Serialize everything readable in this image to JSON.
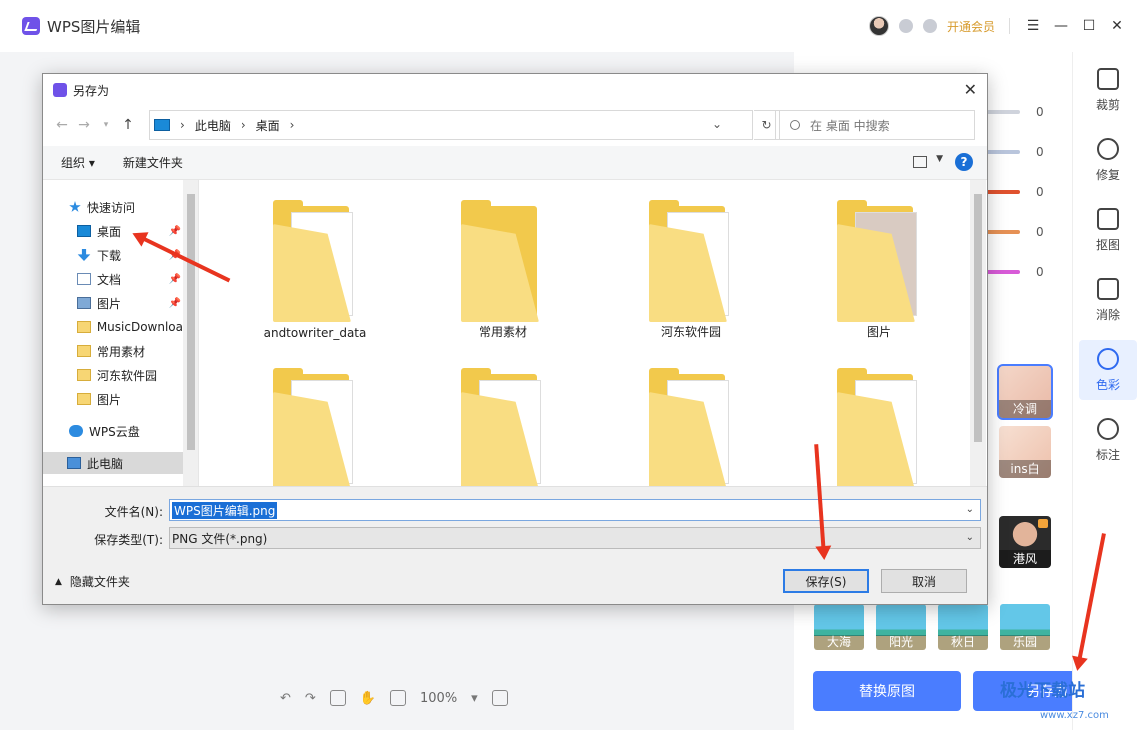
{
  "app": {
    "title": "WPS图片编辑",
    "vip_label": "开通会员"
  },
  "right_panel": {
    "slider_values": [
      "0",
      "0",
      "0",
      "0",
      "0"
    ],
    "slider_colors": [
      "#cfd3dc",
      "#b9c5dc",
      "#e0522e",
      "#e69155",
      "#d85bd8"
    ],
    "filters": [
      {
        "label": "冷调",
        "selected": true
      },
      {
        "label": "ins白",
        "selected": false
      },
      {
        "label": "港风",
        "selected": false
      }
    ],
    "beach_filters": [
      "大海",
      "阳光",
      "秋日",
      "乐园"
    ],
    "replace_button": "替换原图",
    "save_as_button": "另存为"
  },
  "tools": [
    "裁剪",
    "修复",
    "抠图",
    "消除",
    "色彩",
    "标注"
  ],
  "active_tool": "色彩",
  "bottom_toolbar": {
    "zoom": "100%"
  },
  "watermark": {
    "text": "极光下载站",
    "url": "www.xz7.com"
  },
  "dialog": {
    "title": "另存为",
    "breadcrumbs": [
      "此电脑",
      "桌面"
    ],
    "search_placeholder": "在 桌面 中搜索",
    "commands": [
      "组织",
      "新建文件夹"
    ],
    "nav_items": [
      {
        "label": "快速访问",
        "icon": "star-icon"
      },
      {
        "label": "桌面",
        "icon": "desktop-icon",
        "pinned": true
      },
      {
        "label": "下载",
        "icon": "download-icon",
        "pinned": true
      },
      {
        "label": "文档",
        "icon": "document-icon",
        "pinned": true
      },
      {
        "label": "图片",
        "icon": "pictures-icon",
        "pinned": true
      },
      {
        "label": "MusicDownloa",
        "icon": "folder-icon"
      },
      {
        "label": "常用素材",
        "icon": "folder-icon"
      },
      {
        "label": "河东软件园",
        "icon": "folder-icon"
      },
      {
        "label": "图片",
        "icon": "folder-icon"
      },
      {
        "label": "WPS云盘",
        "icon": "cloud-icon"
      },
      {
        "label": "此电脑",
        "icon": "computer-icon",
        "selected": true
      }
    ],
    "files": [
      "andtowriter_data",
      "常用素材",
      "河东软件园",
      "图片",
      "",
      "",
      "",
      ""
    ],
    "filename_label": "文件名(N):",
    "filename_value": "WPS图片编辑.png",
    "filetype_label": "保存类型(T):",
    "filetype_value": "PNG 文件(*.png)",
    "hide_folders": "隐藏文件夹",
    "save_button": "保存(S)",
    "cancel_button": "取消"
  }
}
